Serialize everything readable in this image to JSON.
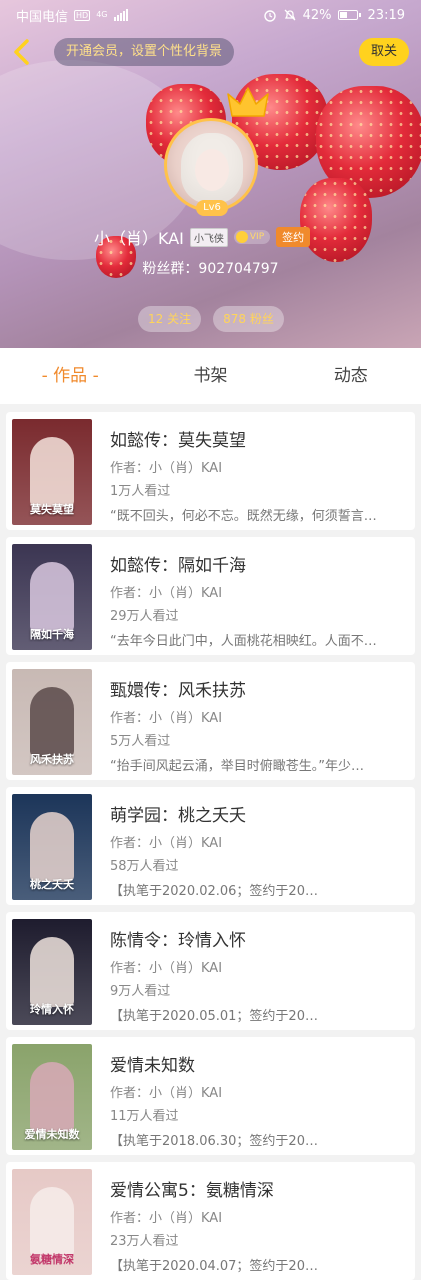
{
  "status_bar": {
    "carrier": "中国电信",
    "hd": "HD",
    "network": "4G",
    "battery": "42%",
    "time": "23:19"
  },
  "header": {
    "vip_prompt": "开通会员，设置个性化背景",
    "close_label": "取关"
  },
  "profile": {
    "level": "Lv6",
    "name": "小（肖）KAI",
    "title_badge": "小飞侠",
    "vip_label": "VIP",
    "sign_label": "签约",
    "fans_group": "粉丝群：902704797",
    "following": "12 关注",
    "followers": "878 粉丝"
  },
  "tabs": [
    {
      "label": "- 作品 -",
      "active": true
    },
    {
      "label": "书架",
      "active": false
    },
    {
      "label": "动态",
      "active": false
    }
  ],
  "works": [
    {
      "title": "如懿传：莫失莫望",
      "author": "作者：小（肖）KAI",
      "views": "1万人看过",
      "desc": "“既不回头，何必不忘。既然无缘，何须誓言…",
      "cover_text": "莫失莫望",
      "cover_color": "#7a2a2e"
    },
    {
      "title": "如懿传：隔如千海",
      "author": "作者：小（肖）KAI",
      "views": "29万人看过",
      "desc": "“去年今日此门中，人面桃花相映红。人面不…",
      "cover_text": "隔如千海",
      "cover_color": "#3b3552"
    },
    {
      "title": "甄嬛传：风禾扶苏",
      "author": "作者：小（肖）KAI",
      "views": "5万人看过",
      "desc": "“抬手间风起云涌，举目时俯瞰苍生。”年少…",
      "cover_text": "风禾扶苏",
      "cover_color": "#c8b9b4"
    },
    {
      "title": "萌学园：桃之夭夭",
      "author": "作者：小（肖）KAI",
      "views": "58万人看过",
      "desc": "【执笔于2020.02.06；签约于20…",
      "cover_text": "桃之夭夭",
      "cover_color": "#1c3559"
    },
    {
      "title": "陈情令：玲情入怀",
      "author": "作者：小（肖）KAI",
      "views": "9万人看过",
      "desc": "【执笔于2020.05.01；签约于20…",
      "cover_text": "玲情入怀",
      "cover_color": "#1e1c2e"
    },
    {
      "title": "爱情未知数",
      "author": "作者：小（肖）KAI",
      "views": "11万人看过",
      "desc": "【执笔于2018.06.30；签约于20…",
      "cover_text": "爱情未知数",
      "cover_color": "#8aa36b"
    },
    {
      "title": "爱情公寓5：氨糖情深",
      "author": "作者：小（肖）KAI",
      "views": "23万人看过",
      "desc": "【执笔于2020.04.07；签约于20…",
      "cover_text": "氨糖情深",
      "cover_color": "#e6c9c6"
    }
  ]
}
